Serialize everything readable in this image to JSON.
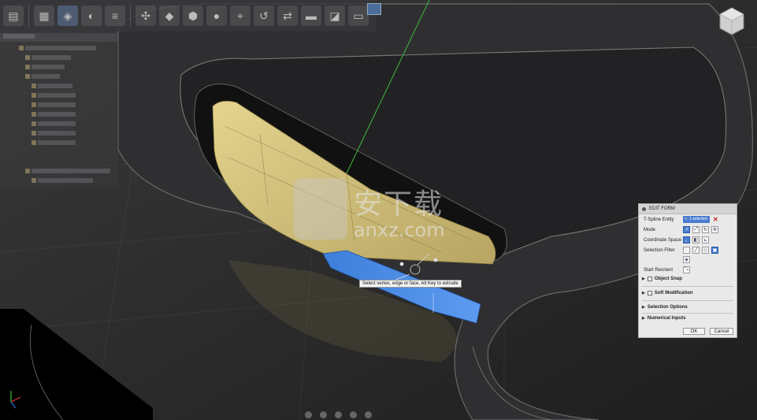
{
  "edit_form": {
    "title": "EDIT FORM",
    "tspline_entity": {
      "label": "T-Spline Entity",
      "value": "1 selected"
    },
    "mode": {
      "label": "Mode"
    },
    "coordinate_space": {
      "label": "Coordinate Space"
    },
    "selection_filter": {
      "label": "Selection Filter"
    },
    "start_reorient": {
      "label": "Start Reorient"
    },
    "object_snap": {
      "label": "Object Snap"
    },
    "soft_modification": {
      "label": "Soft Modification"
    },
    "selection_options": {
      "label": "Selection Options"
    },
    "numerical_inputs": {
      "label": "Numerical Inputs"
    },
    "ok_label": "OK",
    "cancel_label": "Cancel"
  },
  "viewport": {
    "tooltip": "Select vertex, edge or face. Alt Key to extrude"
  },
  "watermark": {
    "cn": "安下载",
    "domain": "anxz.com"
  },
  "colors": {
    "selected_face": "#3d7fd9",
    "surface_yellow": "#d8c880",
    "panel_accent": "#4a7ccf",
    "axis_green": "#3fb93f"
  },
  "icons": [
    "select-icon",
    "cancel-icon",
    "mode-move-icon",
    "mode-scale-icon",
    "mode-rotate-icon",
    "mode-universal-icon",
    "world-space-icon",
    "view-space-icon",
    "local-space-icon",
    "vertex-filter-icon",
    "edge-filter-icon",
    "face-filter-icon",
    "all-filter-icon",
    "body-filter-icon",
    "reorient-icon",
    "viewcube-icon",
    "display-settings-icon"
  ]
}
